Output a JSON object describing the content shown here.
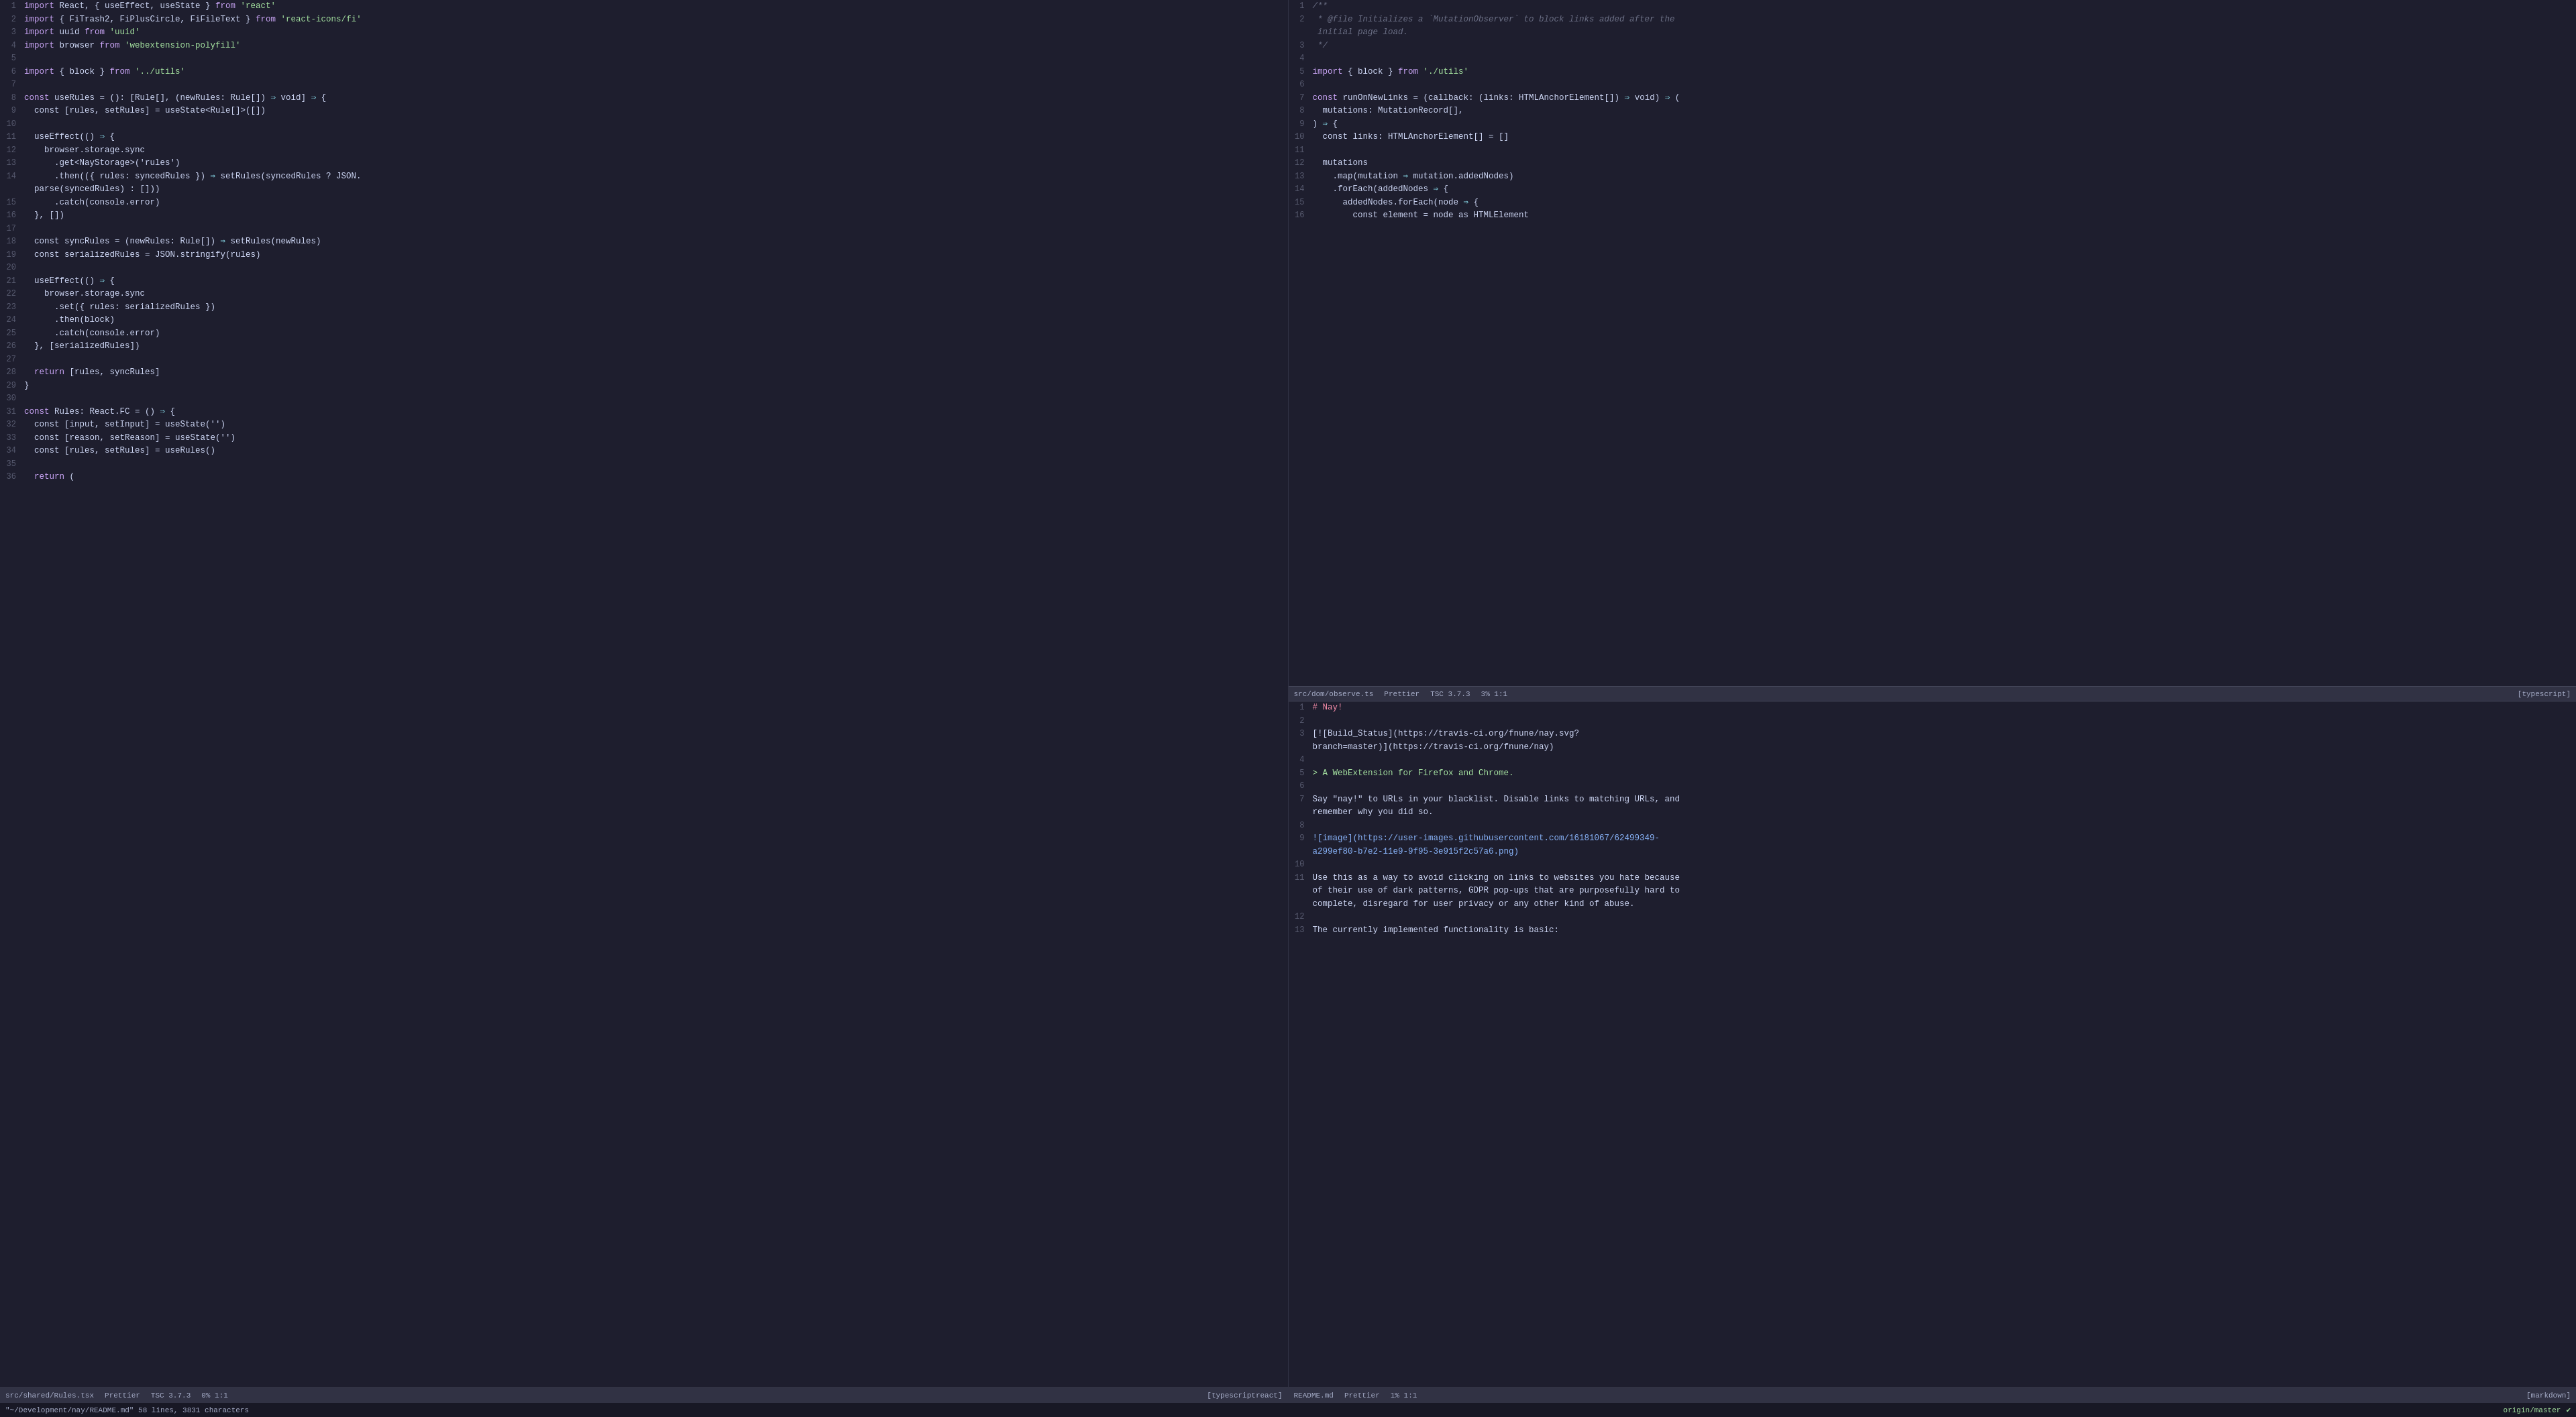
{
  "left_pane": {
    "lines": [
      {
        "num": "1",
        "tokens": [
          {
            "t": "import-kw",
            "v": "import"
          },
          {
            "t": "punc",
            "v": " React, { useEffect, useState } "
          },
          {
            "t": "from-kw",
            "v": "from"
          },
          {
            "t": "punc",
            "v": " "
          },
          {
            "t": "module",
            "v": "'react'"
          }
        ]
      },
      {
        "num": "2",
        "tokens": [
          {
            "t": "import-kw",
            "v": "import"
          },
          {
            "t": "punc",
            "v": " { FiTrash2, FiPlusCircle, FiFileText } "
          },
          {
            "t": "from-kw",
            "v": "from"
          },
          {
            "t": "punc",
            "v": " "
          },
          {
            "t": "module",
            "v": "'react-icons/fi'"
          }
        ]
      },
      {
        "num": "3",
        "tokens": [
          {
            "t": "import-kw",
            "v": "import"
          },
          {
            "t": "punc",
            "v": " uuid "
          },
          {
            "t": "from-kw",
            "v": "from"
          },
          {
            "t": "punc",
            "v": " "
          },
          {
            "t": "module",
            "v": "'uuid'"
          }
        ]
      },
      {
        "num": "4",
        "tokens": [
          {
            "t": "import-kw",
            "v": "import"
          },
          {
            "t": "punc",
            "v": " browser "
          },
          {
            "t": "from-kw",
            "v": "from"
          },
          {
            "t": "punc",
            "v": " "
          },
          {
            "t": "module",
            "v": "'webextension-polyfill'"
          }
        ]
      },
      {
        "num": "5",
        "tokens": []
      },
      {
        "num": "6",
        "tokens": [
          {
            "t": "import-kw",
            "v": "import"
          },
          {
            "t": "punc",
            "v": " { block } "
          },
          {
            "t": "from-kw",
            "v": "from"
          },
          {
            "t": "punc",
            "v": " "
          },
          {
            "t": "module",
            "v": "'../utils'"
          }
        ]
      },
      {
        "num": "7",
        "tokens": []
      },
      {
        "num": "8",
        "tokens": [
          {
            "t": "const-kw",
            "v": "const"
          },
          {
            "t": "punc",
            "v": " useRules = (): [Rule[], (newRules: Rule[]) "
          },
          {
            "t": "arrow",
            "v": "⇒"
          },
          {
            "t": "punc",
            "v": " void] "
          },
          {
            "t": "arrow",
            "v": "⇒"
          },
          {
            "t": "punc",
            "v": " {"
          }
        ]
      },
      {
        "num": "9",
        "tokens": [
          {
            "t": "punc",
            "v": "  const [rules, setRules] = useState<Rule[]>([])"
          }
        ]
      },
      {
        "num": "10",
        "tokens": []
      },
      {
        "num": "11",
        "tokens": [
          {
            "t": "punc",
            "v": "  useEffect(() "
          },
          {
            "t": "arrow",
            "v": "⇒"
          },
          {
            "t": "punc",
            "v": " {"
          }
        ]
      },
      {
        "num": "12",
        "tokens": [
          {
            "t": "punc",
            "v": "    browser.storage.sync"
          }
        ]
      },
      {
        "num": "13",
        "tokens": [
          {
            "t": "punc",
            "v": "      .get<NayStorage>('rules')"
          }
        ]
      },
      {
        "num": "14",
        "tokens": [
          {
            "t": "punc",
            "v": "      .then(({ rules: syncedRules }) "
          },
          {
            "t": "arrow",
            "v": "⇒"
          },
          {
            "t": "punc",
            "v": " setRules(syncedRules ? JSON."
          }
        ]
      },
      {
        "num": "14b",
        "tokens": [
          {
            "t": "punc",
            "v": "  parse(syncedRules) : []))"
          }
        ]
      },
      {
        "num": "15",
        "tokens": [
          {
            "t": "punc",
            "v": "      .catch(console.error)"
          }
        ]
      },
      {
        "num": "16",
        "tokens": [
          {
            "t": "punc",
            "v": "  }, [])"
          }
        ]
      },
      {
        "num": "17",
        "tokens": []
      },
      {
        "num": "18",
        "tokens": [
          {
            "t": "punc",
            "v": "  const syncRules = (newRules: Rule[]) "
          },
          {
            "t": "arrow",
            "v": "⇒"
          },
          {
            "t": "punc",
            "v": " setRules(newRules)"
          }
        ]
      },
      {
        "num": "19",
        "tokens": [
          {
            "t": "punc",
            "v": "  const serializedRules = JSON.stringify(rules)"
          }
        ]
      },
      {
        "num": "20",
        "tokens": []
      },
      {
        "num": "21",
        "tokens": [
          {
            "t": "punc",
            "v": "  useEffect(() "
          },
          {
            "t": "arrow",
            "v": "⇒"
          },
          {
            "t": "punc",
            "v": " {"
          }
        ]
      },
      {
        "num": "22",
        "tokens": [
          {
            "t": "punc",
            "v": "    browser.storage.sync"
          }
        ]
      },
      {
        "num": "23",
        "tokens": [
          {
            "t": "punc",
            "v": "      .set({ rules: serializedRules })"
          }
        ]
      },
      {
        "num": "24",
        "tokens": [
          {
            "t": "punc",
            "v": "      .then(block)"
          }
        ]
      },
      {
        "num": "25",
        "tokens": [
          {
            "t": "punc",
            "v": "      .catch(console.error)"
          }
        ]
      },
      {
        "num": "26",
        "tokens": [
          {
            "t": "punc",
            "v": "  }, [serializedRules])"
          }
        ]
      },
      {
        "num": "27",
        "tokens": []
      },
      {
        "num": "28",
        "tokens": [
          {
            "t": "punc",
            "v": "  "
          },
          {
            "t": "return-kw",
            "v": "return"
          },
          {
            "t": "punc",
            "v": " [rules, syncRules]"
          }
        ]
      },
      {
        "num": "29",
        "tokens": [
          {
            "t": "punc",
            "v": "}"
          }
        ]
      },
      {
        "num": "30",
        "tokens": []
      },
      {
        "num": "31",
        "tokens": [
          {
            "t": "const-kw",
            "v": "const"
          },
          {
            "t": "punc",
            "v": " Rules: React.FC = () "
          },
          {
            "t": "arrow",
            "v": "⇒"
          },
          {
            "t": "punc",
            "v": " {"
          }
        ]
      },
      {
        "num": "32",
        "tokens": [
          {
            "t": "punc",
            "v": "  const [input, setInput] = useState('')"
          }
        ]
      },
      {
        "num": "33",
        "tokens": [
          {
            "t": "punc",
            "v": "  const [reason, setReason] = useState('')"
          }
        ]
      },
      {
        "num": "34",
        "tokens": [
          {
            "t": "punc",
            "v": "  const [rules, setRules] = useRules()"
          }
        ]
      },
      {
        "num": "35",
        "tokens": []
      },
      {
        "num": "36",
        "tokens": [
          {
            "t": "punc",
            "v": "  "
          },
          {
            "t": "return-kw",
            "v": "return"
          },
          {
            "t": "punc",
            "v": " ("
          }
        ]
      }
    ],
    "status": {
      "file": "src/shared/Rules.tsx",
      "formatter": "Prettier",
      "tsc": "TSC 3.7.3",
      "lang": "[typescriptreact]",
      "pos": "0% 1:1"
    }
  },
  "right_pane_top": {
    "lines": [
      {
        "num": "1",
        "tokens": [
          {
            "t": "comment",
            "v": "/**"
          }
        ]
      },
      {
        "num": "2",
        "tokens": [
          {
            "t": "comment",
            "v": " * @file Initializes a `MutationObserver` to block links added after the"
          }
        ]
      },
      {
        "num": "2b",
        "tokens": [
          {
            "t": "comment",
            "v": " initial page load."
          }
        ]
      },
      {
        "num": "3",
        "tokens": [
          {
            "t": "comment",
            "v": " */"
          }
        ]
      },
      {
        "num": "4",
        "tokens": []
      },
      {
        "num": "5",
        "tokens": [
          {
            "t": "import-kw",
            "v": "import"
          },
          {
            "t": "punc",
            "v": " { block } "
          },
          {
            "t": "from-kw",
            "v": "from"
          },
          {
            "t": "punc",
            "v": " "
          },
          {
            "t": "module",
            "v": "'./utils'"
          }
        ]
      },
      {
        "num": "6",
        "tokens": []
      },
      {
        "num": "7",
        "tokens": [
          {
            "t": "const-kw",
            "v": "const"
          },
          {
            "t": "punc",
            "v": " runOnNewLinks = (callback: (links: HTMLAnchorElement[]) "
          },
          {
            "t": "arrow",
            "v": "⇒"
          },
          {
            "t": "punc",
            "v": " void) "
          },
          {
            "t": "arrow",
            "v": "⇒"
          },
          {
            "t": "punc",
            "v": " ("
          }
        ]
      },
      {
        "num": "8",
        "tokens": [
          {
            "t": "punc",
            "v": "  mutations: MutationRecord[],"
          }
        ]
      },
      {
        "num": "9",
        "tokens": [
          {
            "t": "punc",
            "v": ") "
          },
          {
            "t": "arrow",
            "v": "⇒"
          },
          {
            "t": "punc",
            "v": " {"
          }
        ]
      },
      {
        "num": "10",
        "tokens": [
          {
            "t": "punc",
            "v": "  const links: HTMLAnchorElement[] = []"
          }
        ]
      },
      {
        "num": "11",
        "tokens": []
      },
      {
        "num": "12",
        "tokens": [
          {
            "t": "punc",
            "v": "  mutations"
          }
        ]
      },
      {
        "num": "13",
        "tokens": [
          {
            "t": "punc",
            "v": "    .map(mutation "
          },
          {
            "t": "arrow",
            "v": "⇒"
          },
          {
            "t": "punc",
            "v": " mutation.addedNodes)"
          }
        ]
      },
      {
        "num": "14",
        "tokens": [
          {
            "t": "punc",
            "v": "    .forEach(addedNodes "
          },
          {
            "t": "arrow",
            "v": "⇒"
          },
          {
            "t": "punc",
            "v": " {"
          }
        ]
      },
      {
        "num": "15",
        "tokens": [
          {
            "t": "punc",
            "v": "      addedNodes.forEach(node "
          },
          {
            "t": "arrow",
            "v": "⇒"
          },
          {
            "t": "punc",
            "v": " {"
          }
        ]
      },
      {
        "num": "16",
        "tokens": [
          {
            "t": "punc",
            "v": "        const element = node as HTMLElement"
          }
        ]
      }
    ],
    "status": {
      "file": "src/dom/observe.ts",
      "formatter": "Prettier",
      "tsc": "TSC 3.7.3",
      "lang": "[typescript]",
      "pos": "3% 1:1"
    }
  },
  "right_pane_bottom": {
    "lines": [
      {
        "num": "1",
        "tokens": [
          {
            "t": "md-bold",
            "v": "# Nay!"
          }
        ]
      },
      {
        "num": "2",
        "tokens": []
      },
      {
        "num": "3",
        "tokens": [
          {
            "t": "md-normal",
            "v": "[![Build_Status](https://travis-ci.org/fnune/nay.svg?"
          }
        ]
      },
      {
        "num": "3b",
        "tokens": [
          {
            "t": "md-normal",
            "v": "branch=master)](https://travis-ci.org/fnune/nay)"
          }
        ]
      },
      {
        "num": "4",
        "tokens": []
      },
      {
        "num": "5",
        "tokens": [
          {
            "t": "md-quote",
            "v": "> A WebExtension for Firefox and Chrome."
          }
        ]
      },
      {
        "num": "6",
        "tokens": []
      },
      {
        "num": "7",
        "tokens": [
          {
            "t": "md-normal",
            "v": "Say \"nay!\" to URLs in your blacklist. Disable links to matching URLs, and"
          }
        ]
      },
      {
        "num": "7b",
        "tokens": [
          {
            "t": "md-normal",
            "v": "remember why you did so."
          }
        ]
      },
      {
        "num": "8",
        "tokens": []
      },
      {
        "num": "9",
        "tokens": [
          {
            "t": "md-img",
            "v": "![image](https://user-images.githubusercontent.com/16181067/62499349-"
          }
        ]
      },
      {
        "num": "9b",
        "tokens": [
          {
            "t": "md-img",
            "v": "a299ef80-b7e2-11e9-9f95-3e915f2c57a6.png)"
          }
        ]
      },
      {
        "num": "10",
        "tokens": []
      },
      {
        "num": "11",
        "tokens": [
          {
            "t": "md-normal",
            "v": "Use this as a way to avoid clicking on links to websites you hate because"
          }
        ]
      },
      {
        "num": "11b",
        "tokens": [
          {
            "t": "md-normal",
            "v": "of their use of dark patterns, GDPR pop-ups that are purposefully hard to"
          }
        ]
      },
      {
        "num": "11c",
        "tokens": [
          {
            "t": "md-normal",
            "v": "complete, disregard for user privacy or any other kind of abuse."
          }
        ]
      },
      {
        "num": "12",
        "tokens": []
      },
      {
        "num": "13",
        "tokens": [
          {
            "t": "md-normal",
            "v": "The currently implemented functionality is basic:"
          }
        ]
      }
    ],
    "status": {
      "file": "README.md",
      "formatter": "Prettier",
      "lang": "[markdown]",
      "pos": "1% 1:1"
    }
  },
  "bottom_bar": {
    "message": "\"~/Development/nay/README.md\" 58 lines, 3831 characters",
    "git_branch": "origin/master",
    "git_icon": "✔"
  },
  "colors": {
    "bg": "#1e1e2e",
    "status_bg": "#313244",
    "bottom_bg": "#181825",
    "line_num": "#585b70",
    "accent": "#89b4fa"
  }
}
